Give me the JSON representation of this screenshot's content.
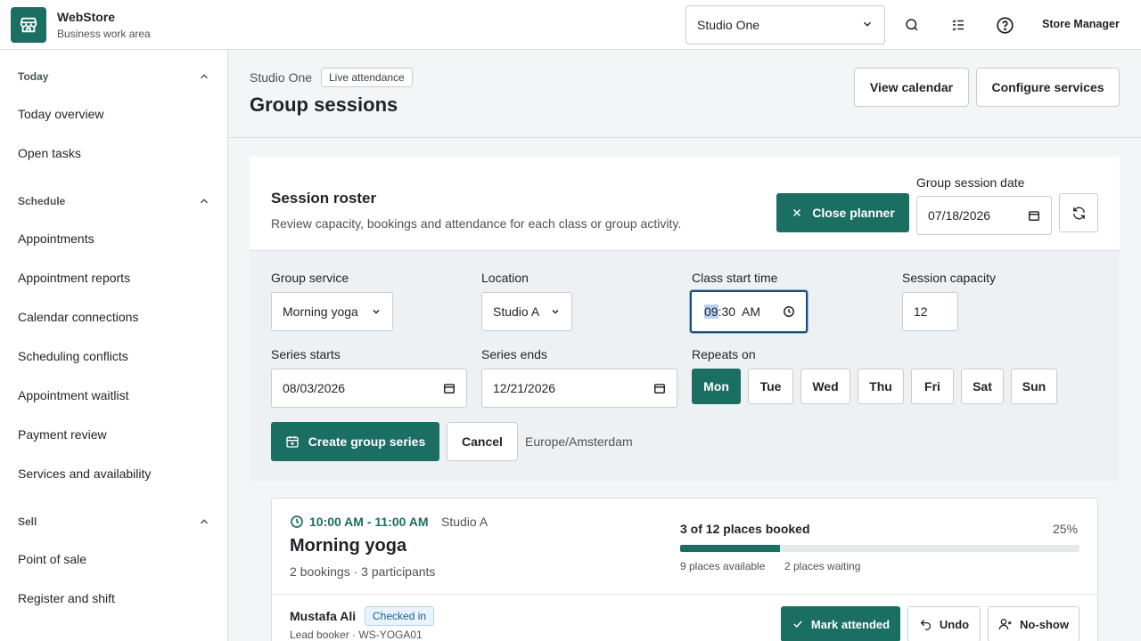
{
  "app": {
    "title": "WebStore",
    "subtitle": "Business work area"
  },
  "header": {
    "store_selector": {
      "value": "Studio One",
      "options": [
        "Studio One"
      ]
    },
    "icons": [
      "search-icon",
      "checklist-icon",
      "help-icon"
    ],
    "user": "Store Manager"
  },
  "sidebar": {
    "sections": [
      {
        "label": "Today",
        "expanded": true,
        "items": [
          "Today overview",
          "Open tasks"
        ]
      },
      {
        "label": "Schedule",
        "expanded": true,
        "items": [
          "Appointments",
          "Appointment reports",
          "Calendar connections",
          "Scheduling conflicts",
          "Appointment waitlist",
          "Payment review",
          "Services and availability"
        ]
      },
      {
        "label": "Sell",
        "expanded": true,
        "items": [
          "Point of sale",
          "Register and shift"
        ]
      }
    ]
  },
  "page": {
    "breadcrumb": "Studio One",
    "tag": "Live attendance",
    "title": "Group sessions",
    "actions": {
      "view_calendar": "View calendar",
      "configure_services": "Configure services"
    }
  },
  "roster": {
    "title": "Session roster",
    "description": "Review capacity, bookings and attendance for each class or group activity.",
    "close_planner": "Close planner",
    "date_label": "Group session date",
    "date_value": "07/18/2026"
  },
  "planner": {
    "service": {
      "label": "Group service",
      "value": "Morning yoga"
    },
    "location": {
      "label": "Location",
      "value": "Studio A"
    },
    "start_time": {
      "label": "Class start time",
      "hour": "09",
      "rest": ":30  AM"
    },
    "capacity": {
      "label": "Session capacity",
      "value": "12"
    },
    "series_starts": {
      "label": "Series starts",
      "value": "08/03/2026"
    },
    "series_ends": {
      "label": "Series ends",
      "value": "12/21/2026"
    },
    "repeats": {
      "label": "Repeats on",
      "days": [
        "Mon",
        "Tue",
        "Wed",
        "Thu",
        "Fri",
        "Sat",
        "Sun"
      ],
      "selected": [
        "Mon"
      ]
    },
    "create": "Create group series",
    "cancel": "Cancel",
    "timezone": "Europe/Amsterdam"
  },
  "session": {
    "time": "10:00 AM - 11:00 AM",
    "location": "Studio A",
    "title": "Morning yoga",
    "summary": "2 bookings · 3 participants",
    "booked_text": "3 of 12 places booked",
    "percent_text": "25%",
    "fill_fraction": 0.25,
    "available": "9 places available",
    "waiting": "2 places waiting",
    "attendee": {
      "name": "Mustafa Ali",
      "status": "Checked in",
      "sub": "Lead booker · WS-YOGA01",
      "actions": {
        "mark_attended": "Mark attended",
        "undo": "Undo",
        "no_show": "No-show"
      }
    }
  },
  "colors": {
    "brand": "#1b6e62",
    "badge_blue": "#1f5f8b"
  }
}
